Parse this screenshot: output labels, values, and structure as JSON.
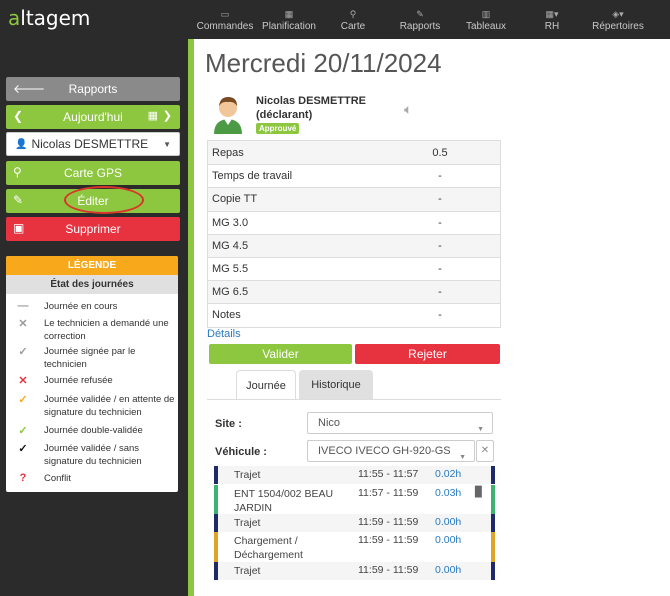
{
  "app": {
    "logo_a": "a",
    "logo_rest": "ltagem"
  },
  "nav": [
    {
      "label": "Commandes",
      "icon": "inbox-icon"
    },
    {
      "label": "Planification",
      "icon": "calendar-icon"
    },
    {
      "label": "Carte",
      "icon": "map-pin-icon"
    },
    {
      "label": "Rapports",
      "icon": "edit-icon"
    },
    {
      "label": "Tableaux",
      "icon": "table-icon"
    },
    {
      "label": "RH",
      "icon": "grid-icon"
    },
    {
      "label": "Répertoires",
      "icon": "cube-icon"
    }
  ],
  "sidebar": {
    "rapports": "Rapports",
    "today": "Aujourd'hui",
    "user_select": "Nicolas DESMETTRE",
    "gps": "Carte GPS",
    "edit": "Éditer",
    "delete": "Supprimer"
  },
  "legend": {
    "title": "LÉGENDE",
    "subtitle": "État des journées",
    "items": [
      {
        "symbol": "—",
        "color": "#999999",
        "text": "Journée en cours"
      },
      {
        "symbol": "✕",
        "color": "#999999",
        "text": "Le technicien a demandé une correction"
      },
      {
        "symbol": "✓",
        "color": "#999999",
        "text": "Journée signée par le technicien"
      },
      {
        "symbol": "✕",
        "color": "#e73240",
        "text": "Journée refusée"
      },
      {
        "symbol": "✓",
        "color": "#f7a81b",
        "text": "Journée validée / en attente de signature du technicien"
      },
      {
        "symbol": "✓",
        "color": "#8dc63f",
        "text": "Journée double-validée"
      },
      {
        "symbol": "✓",
        "color": "#111111",
        "text": "Journée validée / sans signature du technicien"
      },
      {
        "symbol": "?",
        "color": "#e73240",
        "text": "Conflit"
      }
    ]
  },
  "main": {
    "title": "Mercredi 20/11/2024",
    "user_name": "Nicolas DESMETTRE",
    "user_role": "(déclarant)",
    "badge": "Approuvé",
    "rows": [
      {
        "key": "Repas",
        "value": "0.5"
      },
      {
        "key": "Temps de travail",
        "value": "-"
      },
      {
        "key": "Copie TT",
        "value": "-"
      },
      {
        "key": "MG 3.0",
        "value": "-"
      },
      {
        "key": "MG 4.5",
        "value": "-"
      },
      {
        "key": "MG 5.5",
        "value": "-"
      },
      {
        "key": "MG 6.5",
        "value": "-"
      },
      {
        "key": "Notes",
        "value": "-"
      }
    ],
    "details": "Détails",
    "validate": "Valider",
    "reject": "Rejeter",
    "tabs": [
      "Journée",
      "Historique"
    ],
    "site_label": "Site :",
    "site_value": "Nico",
    "vehicle_label": "Véhicule :",
    "vehicle_value": "IVECO IVECO GH-920-GS",
    "trips": [
      {
        "label": "Trajet",
        "time": "11:55 - 11:57",
        "duration": "0.02h",
        "color_left": "#1f2a6b",
        "color_right": "#1f2a6b",
        "doc": false
      },
      {
        "label": "ENT 1504/002 BEAU JARDIN",
        "time": "11:57 - 11:59",
        "duration": "0.03h",
        "color_left": "#3cb371",
        "color_right": "#3cb371",
        "doc": true
      },
      {
        "label": "Trajet",
        "time": "11:59 - 11:59",
        "duration": "0.00h",
        "color_left": "#1f2a6b",
        "color_right": "#1f2a6b",
        "doc": false
      },
      {
        "label": "Chargement / Déchargement",
        "time": "11:59 - 11:59",
        "duration": "0.00h",
        "color_left": "#e0a526",
        "color_right": "#e0a526",
        "doc": false
      },
      {
        "label": "Trajet",
        "time": "11:59 - 11:59",
        "duration": "0.00h",
        "color_left": "#1f2a6b",
        "color_right": "#1f2a6b",
        "doc": false
      }
    ]
  }
}
